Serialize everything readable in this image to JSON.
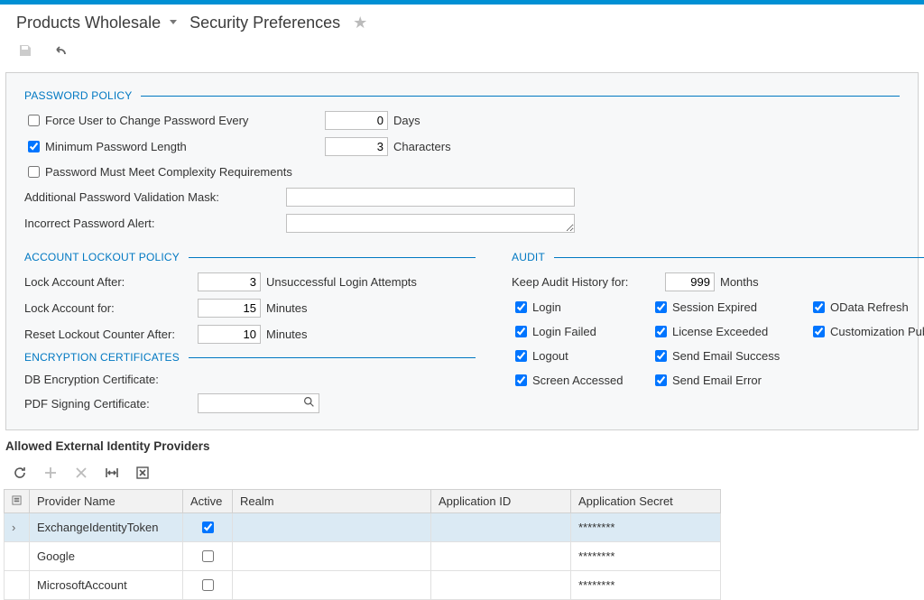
{
  "header": {
    "product": "Products Wholesale",
    "page": "Security Preferences"
  },
  "passwordPolicy": {
    "title": "PASSWORD POLICY",
    "forceChange": {
      "label": "Force User to Change Password Every",
      "checked": false,
      "value": "0",
      "unit": "Days"
    },
    "minLength": {
      "label": "Minimum Password Length",
      "checked": true,
      "value": "3",
      "unit": "Characters"
    },
    "complexity": {
      "label": "Password Must Meet Complexity Requirements",
      "checked": false
    },
    "maskLabel": "Additional Password Validation Mask:",
    "alertLabel": "Incorrect Password Alert:"
  },
  "lockout": {
    "title": "ACCOUNT LOCKOUT POLICY",
    "lockAfter": {
      "label": "Lock Account After:",
      "value": "3",
      "unit": "Unsuccessful Login Attempts"
    },
    "lockFor": {
      "label": "Lock Account for:",
      "value": "15",
      "unit": "Minutes"
    },
    "resetAfter": {
      "label": "Reset Lockout Counter After:",
      "value": "10",
      "unit": "Minutes"
    }
  },
  "encryption": {
    "title": "ENCRYPTION CERTIFICATES",
    "dbCertLabel": "DB Encryption Certificate:",
    "pdfCertLabel": "PDF Signing Certificate:"
  },
  "audit": {
    "title": "AUDIT",
    "keepHistory": {
      "label": "Keep Audit History for:",
      "value": "999",
      "unit": "Months"
    },
    "items": {
      "login": {
        "label": "Login",
        "checked": true
      },
      "loginFailed": {
        "label": "Login Failed",
        "checked": true
      },
      "logout": {
        "label": "Logout",
        "checked": true
      },
      "screen": {
        "label": "Screen Accessed",
        "checked": true
      },
      "session": {
        "label": "Session Expired",
        "checked": true
      },
      "license": {
        "label": "License Exceeded",
        "checked": true
      },
      "emailOk": {
        "label": "Send Email Success",
        "checked": true
      },
      "emailErr": {
        "label": "Send Email Error",
        "checked": true
      },
      "odata": {
        "label": "OData Refresh",
        "checked": true
      },
      "custPub": {
        "label": "Customization Published",
        "checked": true
      }
    }
  },
  "providers": {
    "title": "Allowed External Identity Providers",
    "columns": {
      "name": "Provider Name",
      "active": "Active",
      "realm": "Realm",
      "appId": "Application ID",
      "appSecret": "Application Secret"
    },
    "rows": [
      {
        "name": "ExchangeIdentityToken",
        "active": true,
        "realm": "",
        "appId": "",
        "secret": "********",
        "selected": true
      },
      {
        "name": "Google",
        "active": false,
        "realm": "",
        "appId": "",
        "secret": "********",
        "selected": false
      },
      {
        "name": "MicrosoftAccount",
        "active": false,
        "realm": "",
        "appId": "",
        "secret": "********",
        "selected": false
      }
    ]
  }
}
